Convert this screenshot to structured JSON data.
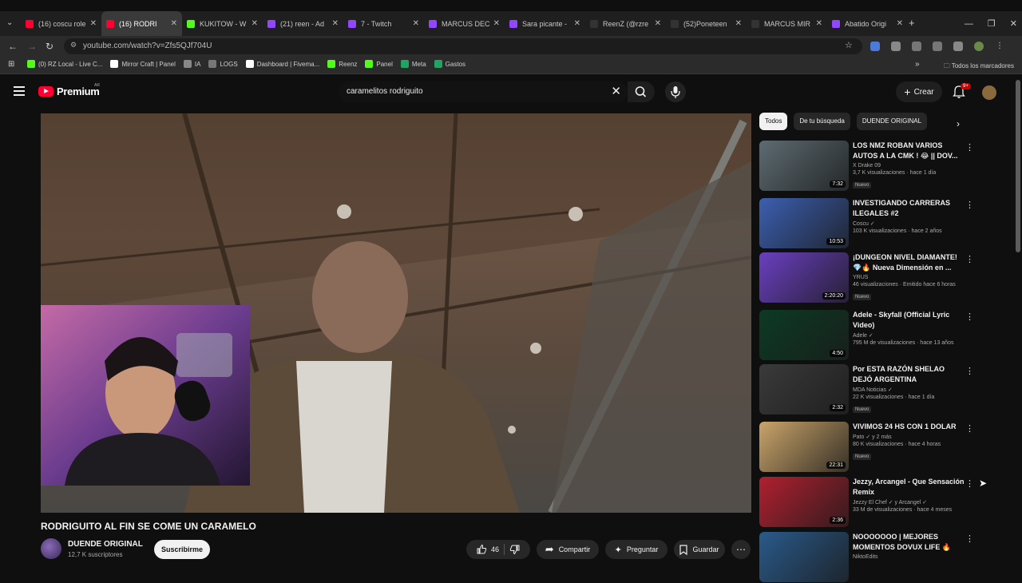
{
  "browser": {
    "tabs": [
      {
        "title": "(16) coscu role",
        "color": "#ff0033"
      },
      {
        "title": "(16) RODRI",
        "color": "#ff0033",
        "active": true
      },
      {
        "title": "KUKITOW - W",
        "color": "#53fc18"
      },
      {
        "title": "(21) reen - Ad",
        "color": "#9146ff"
      },
      {
        "title": "7 - Twitch",
        "color": "#9146ff"
      },
      {
        "title": "MARCUS DEC",
        "color": "#9146ff"
      },
      {
        "title": "Sara picante -",
        "color": "#9146ff"
      },
      {
        "title": "ReenZ (@rzre",
        "color": "#333333"
      },
      {
        "title": "(52)Poneteen",
        "color": "#333333"
      },
      {
        "title": "MARCUS MIR",
        "color": "#333333"
      },
      {
        "title": "Abatido Origi",
        "color": "#9146ff"
      }
    ],
    "url": "youtube.com/watch?v=Zfs5QJf704U",
    "bookmarks": [
      {
        "label": "(0) RZ Local - Live C...",
        "color": "#53fc18"
      },
      {
        "label": "Mirror Craft | Panel",
        "color": "#ffffff"
      },
      {
        "label": "IA",
        "color": "#888888"
      },
      {
        "label": "LOGS",
        "color": "#777777"
      },
      {
        "label": "Dashboard | Fivema...",
        "color": "#ffffff"
      },
      {
        "label": "Reenz",
        "color": "#53fc18"
      },
      {
        "label": "Panel",
        "color": "#53fc18"
      },
      {
        "label": "Meta",
        "color": "#1fa463"
      },
      {
        "label": "Gastos",
        "color": "#1fa463"
      }
    ],
    "all_bookmarks": "Todos los marcadores"
  },
  "youtube": {
    "logo_text": "Premium",
    "country": "AR",
    "search_query": "caramelitos rodriguito",
    "create_label": "Crear",
    "notif_count": "9+"
  },
  "video": {
    "title": "RODRIGUITO AL FIN SE COME UN CARAMELO",
    "channel": "DUENDE ORIGINAL",
    "subscribers": "12,7 K suscriptores",
    "subscribe_label": "Suscribirme",
    "likes": "46",
    "share_label": "Compartir",
    "ask_label": "Preguntar",
    "save_label": "Guardar"
  },
  "chips": [
    "Todos",
    "De tu búsqueda",
    "DUENDE ORIGINAL"
  ],
  "recommendations": [
    {
      "title": "LOS NMZ ROBAN VARIOS AUTOS A LA CMK ! 😂 || DOV...",
      "channel": "X Drake 09",
      "meta": "3,7 K visualizaciones · hace 1 día",
      "duration": "7:32",
      "badge": "Nuevo",
      "thumb": "#5d6b72"
    },
    {
      "title": "INVESTIGANDO CARRERAS ILEGALES #2",
      "channel": "Coscu ✓",
      "meta": "103 K visualizaciones · hace 2 años",
      "duration": "10:53",
      "badge": "",
      "thumb": "#3c5fb0"
    },
    {
      "title": "¡DUNGEON NIVEL DIAMANTE! 💎🔥 Nueva Dimensión en ...",
      "channel": "YRUS",
      "meta": "46 visualizaciones · Emitido hace 6 horas",
      "duration": "2:20:20",
      "badge": "Nuevo",
      "thumb": "#6a3fc0"
    },
    {
      "title": "Adele - Skyfall (Official Lyric Video)",
      "channel": "Adele ✓",
      "meta": "795 M de visualizaciones · hace 13 años",
      "duration": "4:50",
      "badge": "",
      "thumb": "#0c3a24"
    },
    {
      "title": "Por ESTA RAZÓN SHELAO DEJÓ ARGENTINA",
      "channel": "MDA Noticias ✓",
      "meta": "22 K visualizaciones · hace 1 día",
      "duration": "2:32",
      "badge": "Nuevo",
      "thumb": "#3a3a3a"
    },
    {
      "title": "VIVIMOS 24 HS CON 1 DOLAR",
      "channel": "Pato ✓ y 2 más",
      "meta": "80 K visualizaciones · hace 4 horas",
      "duration": "22:31",
      "badge": "Nuevo",
      "thumb": "#c9a46a"
    },
    {
      "title": "Jezzy, Arcangel - Que Sensación Remix",
      "channel": "Jezzy El Chef ✓ y Arcangel ✓",
      "meta": "33 M de visualizaciones · hace 4 meses",
      "duration": "2:36",
      "badge": "",
      "thumb": "#b02030"
    },
    {
      "title": "NOOOOOOO | MEJORES MOMENTOS DOVUX LIFE 🔥",
      "channel": "NiktoEdits",
      "meta": "",
      "duration": "",
      "badge": "",
      "thumb": "#2a5a8a"
    }
  ]
}
